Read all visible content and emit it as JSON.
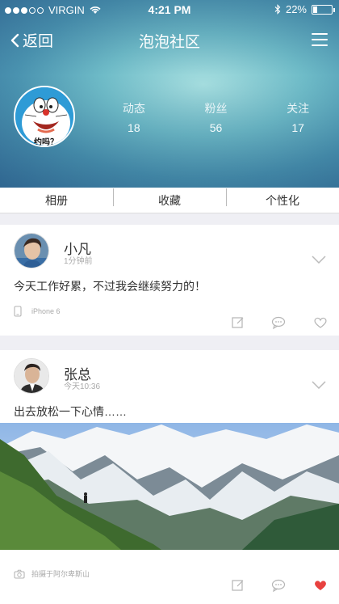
{
  "status_bar": {
    "carrier": "VIRGIN",
    "time": "4:21 PM",
    "battery": "22%",
    "signal_bars": 3,
    "signal_total": 5
  },
  "nav": {
    "back_label": "返回",
    "title": "泡泡社区"
  },
  "profile": {
    "avatar_caption": "约吗？",
    "stats": [
      {
        "label": "动态",
        "value": "18"
      },
      {
        "label": "粉丝",
        "value": "56"
      },
      {
        "label": "关注",
        "value": "17"
      }
    ]
  },
  "tabs": [
    "相册",
    "收藏",
    "个性化"
  ],
  "posts": [
    {
      "name": "小凡",
      "time": "1分钟前",
      "text": "今天工作好累，不过我会继续努力的！",
      "meta": "iPhone 6",
      "liked": false
    },
    {
      "name": "张总",
      "time": "今天10:36",
      "text": "出去放松一下心情……",
      "meta": "拍摄于阿尔卑斯山",
      "liked": true
    }
  ],
  "colors": {
    "accent_like": "#e8413f",
    "icon_gray": "#b5b5b5",
    "background": "#efeff4"
  }
}
